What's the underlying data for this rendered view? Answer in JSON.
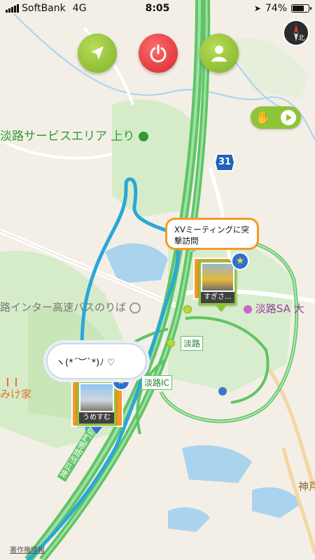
{
  "status_bar": {
    "carrier": "SoftBank",
    "network": "4G",
    "time": "8:05",
    "battery_text": "74%",
    "battery_level": 0.74,
    "location_icon": "location-arrow-icon"
  },
  "toolbar": {
    "navigate_icon": "navigation-arrow-icon",
    "power_icon": "power-icon",
    "profile_icon": "user-icon"
  },
  "compass": {
    "icon": "compass-icon",
    "label": "北"
  },
  "gesture_control": {
    "hand_icon": "hand-icon",
    "play_icon": "play-icon"
  },
  "map": {
    "labels": {
      "service_area_up": "淡路サービスエリア 上り",
      "route_number": "31",
      "interchange_bus": "路インター高速バスのりば",
      "awaji_sa": "淡路SA 大",
      "awaji_small": "淡路",
      "awaji_ic": "淡路IC",
      "kamiya_house": "みけ家",
      "road_name": "神戸淡路鳴門自動車道",
      "kobe_short": "神戸"
    },
    "colors": {
      "route_line": "#2aa7d8",
      "expressway": "#5fc466",
      "park": "#cfe8c4",
      "water": "#aad3ee",
      "accent_green": "#8ec43a",
      "accent_red": "#d7262e",
      "bubble_border": "#f39a2a"
    }
  },
  "posts": [
    {
      "message": "XVミーティングに突撃訪問",
      "caption": "すぎさ…"
    },
    {
      "message": "ヽ(*´︶`*)ﾉ ♡",
      "caption": "うめすむ"
    }
  ],
  "copyright": "著作権情報"
}
